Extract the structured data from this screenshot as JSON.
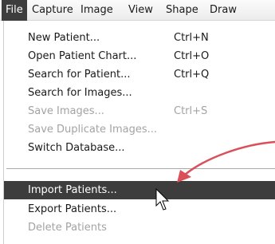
{
  "menubar": {
    "items": [
      {
        "label": "File"
      },
      {
        "label": "Capture"
      },
      {
        "label": "Image"
      },
      {
        "label": "View"
      },
      {
        "label": "Shape"
      },
      {
        "label": "Draw"
      }
    ]
  },
  "file_menu": {
    "items": [
      {
        "label": "New Patient...",
        "shortcut": "Ctrl+N"
      },
      {
        "label": "Open Patient Chart...",
        "shortcut": "Ctrl+O"
      },
      {
        "label": "Search for Patient...",
        "shortcut": "Ctrl+Q"
      },
      {
        "label": "Search for Images..."
      },
      {
        "label": "Save Images...",
        "shortcut": "Ctrl+S"
      },
      {
        "label": "Save Duplicate Images..."
      },
      {
        "label": "Switch Database..."
      },
      {
        "label": "Import Patients..."
      },
      {
        "label": "Export Patients..."
      },
      {
        "label": "Delete Patients"
      }
    ]
  },
  "annotation": {
    "arrow_color": "#d9505a",
    "highlight_color": "#3d3d3d"
  }
}
